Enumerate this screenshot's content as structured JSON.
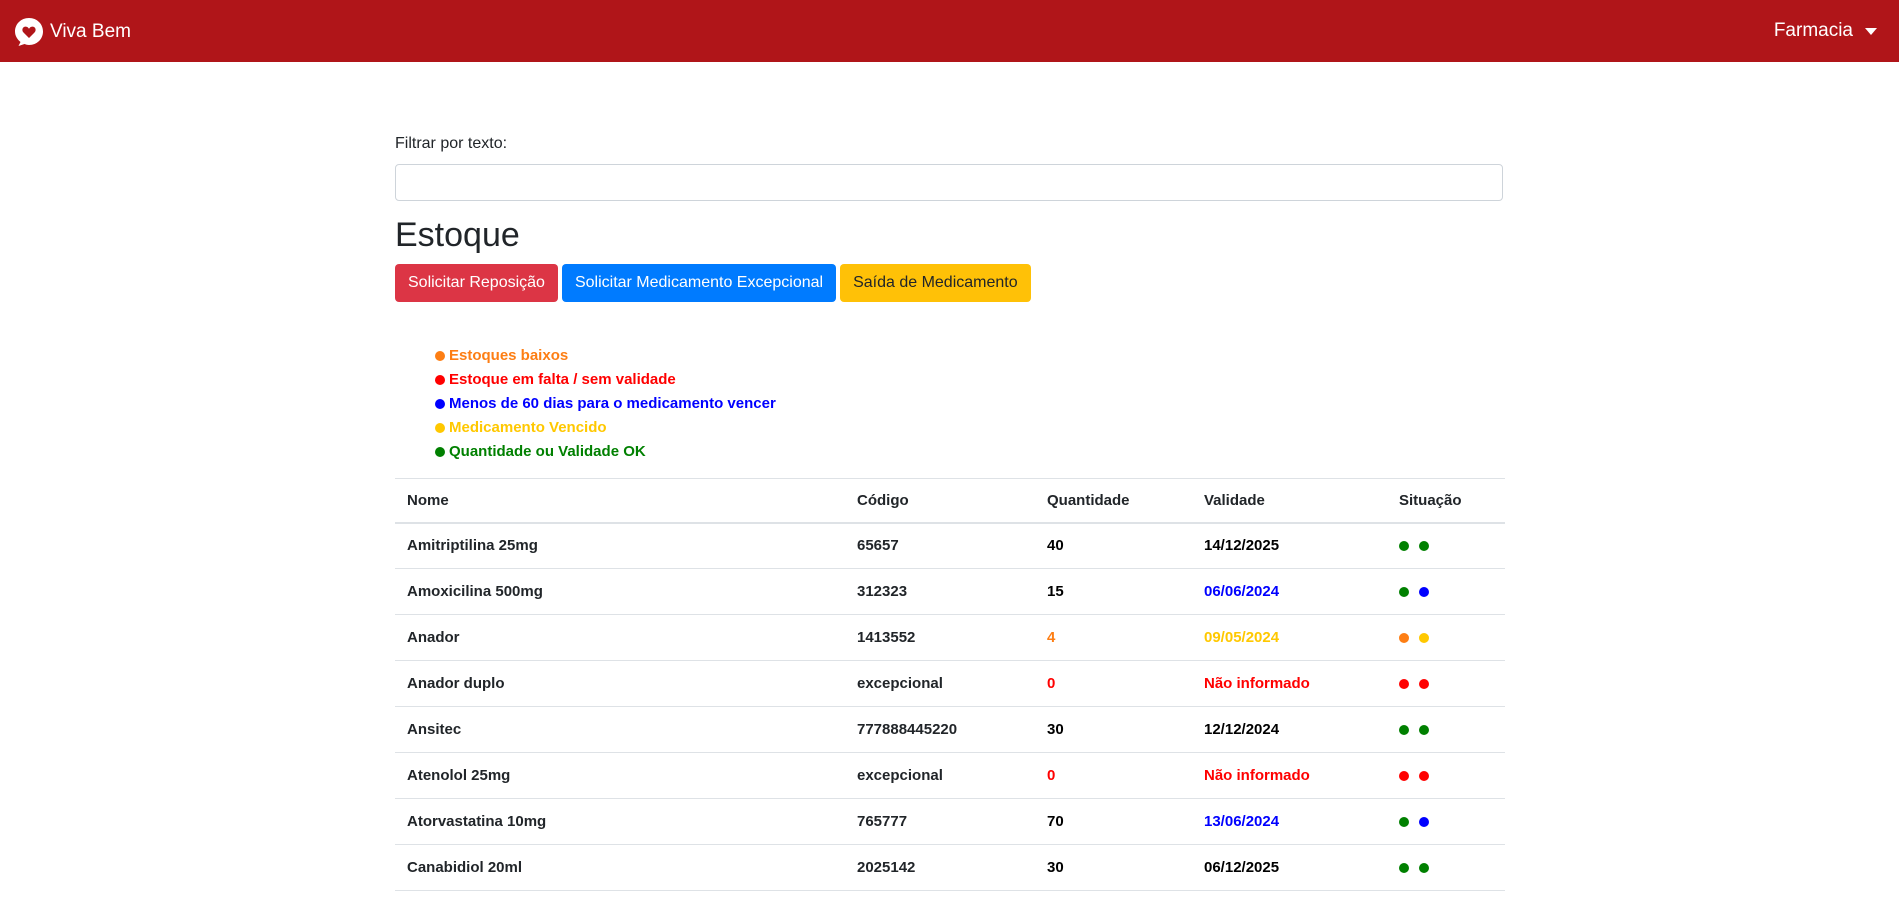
{
  "navbar": {
    "brand": "Viva Bem",
    "menu_label": "Farmacia"
  },
  "filter": {
    "label": "Filtrar por texto:",
    "value": ""
  },
  "page_title": "Estoque",
  "buttons": {
    "request_restock": "Solicitar Reposição",
    "request_exceptional": "Solicitar Medicamento Excepcional",
    "medication_exit": "Saída de Medicamento"
  },
  "legend": [
    {
      "label": "Estoques baixos",
      "color": "#fd7e14"
    },
    {
      "label": "Estoque em falta / sem validade",
      "color": "#ff0000"
    },
    {
      "label": "Menos de 60 dias para o medicamento vencer",
      "color": "#0000ff"
    },
    {
      "label": "Medicamento Vencido",
      "color": "#ffc800"
    },
    {
      "label": "Quantidade ou Validade OK",
      "color": "#008000"
    }
  ],
  "table": {
    "headers": [
      "Nome",
      "Código",
      "Quantidade",
      "Validade",
      "Situação"
    ],
    "rows": [
      {
        "name": "Amitriptilina 25mg",
        "code": "65657",
        "qty": "40",
        "qty_color": "#000000",
        "validity": "14/12/2025",
        "validity_color": "#000000",
        "status": [
          "#008000",
          "#008000"
        ]
      },
      {
        "name": "Amoxicilina 500mg",
        "code": "312323",
        "qty": "15",
        "qty_color": "#000000",
        "validity": "06/06/2024",
        "validity_color": "#0000ff",
        "status": [
          "#008000",
          "#0000ff"
        ]
      },
      {
        "name": "Anador",
        "code": "1413552",
        "qty": "4",
        "qty_color": "#fd7e14",
        "validity": "09/05/2024",
        "validity_color": "#ffc800",
        "status": [
          "#fd7e14",
          "#ffc800"
        ]
      },
      {
        "name": "Anador duplo",
        "code": "excepcional",
        "qty": "0",
        "qty_color": "#ff0000",
        "validity": "Não informado",
        "validity_color": "#ff0000",
        "status": [
          "#ff0000",
          "#ff0000"
        ]
      },
      {
        "name": "Ansitec",
        "code": "777888445220",
        "qty": "30",
        "qty_color": "#000000",
        "validity": "12/12/2024",
        "validity_color": "#000000",
        "status": [
          "#008000",
          "#008000"
        ]
      },
      {
        "name": "Atenolol 25mg",
        "code": "excepcional",
        "qty": "0",
        "qty_color": "#ff0000",
        "validity": "Não informado",
        "validity_color": "#ff0000",
        "status": [
          "#ff0000",
          "#ff0000"
        ]
      },
      {
        "name": "Atorvastatina 10mg",
        "code": "765777",
        "qty": "70",
        "qty_color": "#000000",
        "validity": "13/06/2024",
        "validity_color": "#0000ff",
        "status": [
          "#008000",
          "#0000ff"
        ]
      },
      {
        "name": "Canabidiol 20ml",
        "code": "2025142",
        "qty": "30",
        "qty_color": "#000000",
        "validity": "06/12/2025",
        "validity_color": "#000000",
        "status": [
          "#008000",
          "#008000"
        ]
      }
    ]
  }
}
